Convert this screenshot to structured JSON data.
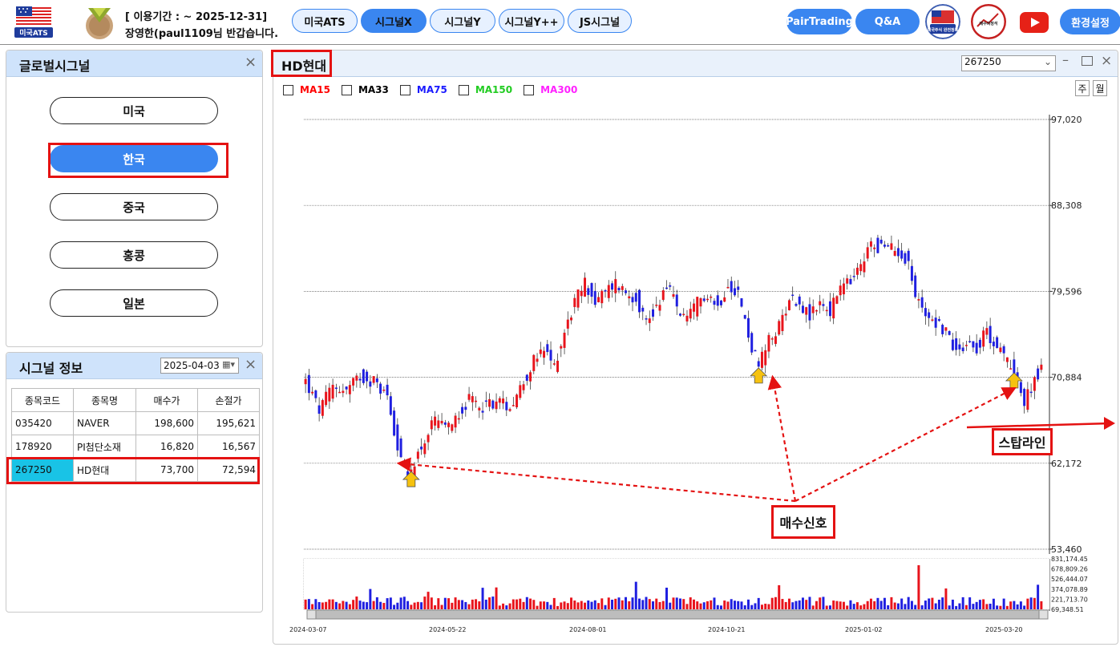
{
  "header": {
    "logo_text": "미국ATS",
    "period_line": "[ 이용기간 : ~ 2025-12-31]",
    "welcome_line": "장영한(paul1109님 반갑습니다.",
    "nav": [
      {
        "label": "미국ATS",
        "active": false
      },
      {
        "label": "시그널X",
        "active": true
      },
      {
        "label": "시그널Y",
        "active": false
      },
      {
        "label": "시그널Y++",
        "active": false
      },
      {
        "label": "JS시그널",
        "active": false
      }
    ],
    "right_buttons": {
      "pair": "PairTrading",
      "qa": "Q&A",
      "settings": "환경설정"
    },
    "round_logo1_text": "미국주식 완전정복",
    "round_logo2_text": "매수의정석"
  },
  "global_signal": {
    "title": "글로벌시그널",
    "markets": [
      "미국",
      "한국",
      "중국",
      "홍콩",
      "일본"
    ],
    "selected": "한국"
  },
  "signal_info": {
    "title": "시그널 정보",
    "date": "2025-04-03",
    "columns": [
      "종목코드",
      "종목명",
      "매수가",
      "손절가"
    ],
    "rows": [
      [
        "035420",
        "NAVER",
        "198,600",
        "195,621"
      ],
      [
        "178920",
        "PI첨단소재",
        "16,820",
        "16,567"
      ],
      [
        "267250",
        "HD현대",
        "73,700",
        "72,594"
      ]
    ],
    "selected_row": 2
  },
  "chart_panel": {
    "title": "HD현대",
    "code_select": "267250",
    "ma_items": [
      {
        "label": "MA15",
        "color": "#ff0000"
      },
      {
        "label": "MA33",
        "color": "#000000"
      },
      {
        "label": "MA75",
        "color": "#1a1aff"
      },
      {
        "label": "MA150",
        "color": "#22cc22"
      },
      {
        "label": "MA300",
        "color": "#ff22ff"
      }
    ],
    "timeframe": [
      "주",
      "월"
    ],
    "annotations": {
      "buy_signal": "매수신호",
      "stop_line": "스탑라인"
    }
  },
  "chart_data": {
    "type": "candlestick",
    "y_ticks": [
      "97,020",
      "88,308",
      "79,596",
      "70,884",
      "62,172",
      "53,460"
    ],
    "ylim": [
      53460,
      97020
    ],
    "volume_ticks": [
      "831,174.45",
      "678,809.26",
      "526,444.07",
      "374,078.89",
      "221,713.70",
      "69,348.51"
    ],
    "x_ticks": [
      "2024-03-07",
      "2024-05-22",
      "2024-08-01",
      "2024-10-21",
      "2025-01-02",
      "2025-03-20"
    ],
    "up_color": "#e8141c",
    "down_color": "#1f1fe0",
    "close_path": [
      [
        0,
        70500
      ],
      [
        4,
        67500
      ],
      [
        8,
        70000
      ],
      [
        12,
        69500
      ],
      [
        16,
        71000
      ],
      [
        20,
        70500
      ],
      [
        24,
        69000
      ],
      [
        27,
        64000
      ],
      [
        30,
        60500
      ],
      [
        32,
        62500
      ],
      [
        35,
        64500
      ],
      [
        38,
        66500
      ],
      [
        41,
        65500
      ],
      [
        44,
        67000
      ],
      [
        48,
        68500
      ],
      [
        52,
        68000
      ],
      [
        56,
        68500
      ],
      [
        60,
        68000
      ],
      [
        64,
        70500
      ],
      [
        67,
        72500
      ],
      [
        70,
        73500
      ],
      [
        73,
        72000
      ],
      [
        76,
        75500
      ],
      [
        79,
        78500
      ],
      [
        82,
        80500
      ],
      [
        85,
        78500
      ],
      [
        88,
        79500
      ],
      [
        91,
        80500
      ],
      [
        94,
        79500
      ],
      [
        97,
        79000
      ],
      [
        100,
        76500
      ],
      [
        103,
        78000
      ],
      [
        106,
        80500
      ],
      [
        109,
        78000
      ],
      [
        112,
        76500
      ],
      [
        115,
        78500
      ],
      [
        118,
        79500
      ],
      [
        121,
        78000
      ],
      [
        124,
        80500
      ],
      [
        127,
        79500
      ],
      [
        130,
        75000
      ],
      [
        133,
        72000
      ],
      [
        136,
        74500
      ],
      [
        139,
        76000
      ],
      [
        142,
        79000
      ],
      [
        145,
        78500
      ],
      [
        148,
        77000
      ],
      [
        151,
        78500
      ],
      [
        154,
        77500
      ],
      [
        157,
        80000
      ],
      [
        160,
        80500
      ],
      [
        163,
        82000
      ],
      [
        166,
        84500
      ],
      [
        169,
        84000
      ],
      [
        172,
        84000
      ],
      [
        175,
        83500
      ],
      [
        177,
        82500
      ],
      [
        179,
        79000
      ],
      [
        182,
        77500
      ],
      [
        185,
        76500
      ],
      [
        188,
        75500
      ],
      [
        191,
        73500
      ],
      [
        194,
        74500
      ],
      [
        197,
        74000
      ],
      [
        200,
        75500
      ],
      [
        203,
        74000
      ],
      [
        206,
        72500
      ],
      [
        209,
        71000
      ],
      [
        211,
        68000
      ],
      [
        214,
        71000
      ],
      [
        216,
        71500
      ]
    ],
    "buy_signals_idx": [
      31,
      133,
      208
    ]
  }
}
